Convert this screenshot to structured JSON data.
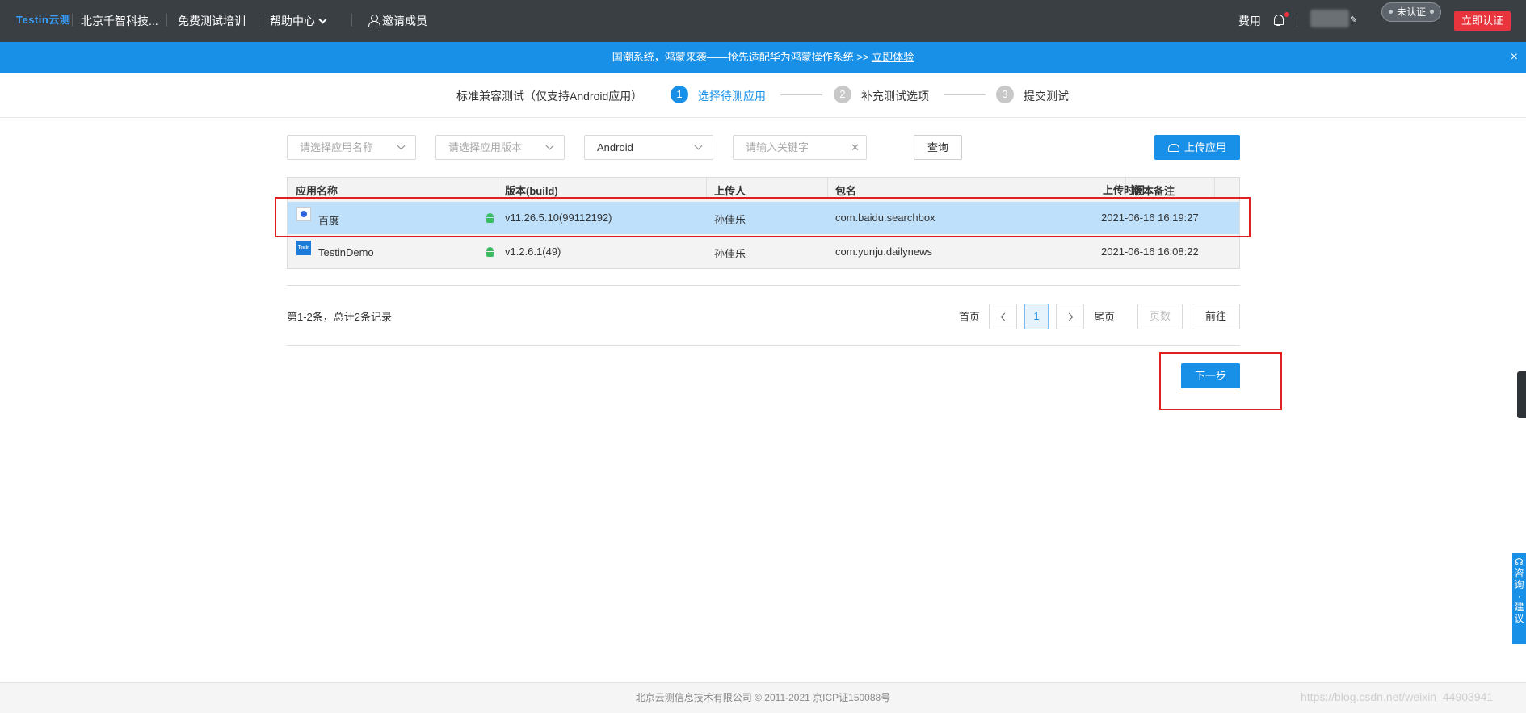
{
  "topnav": {
    "logo": "Testin云测",
    "company": "北京千智科技...",
    "training": "免费测试培训",
    "help": "帮助中心",
    "invite": "邀请成员",
    "fee": "费用",
    "unverified": "未认证",
    "certify": "立即认证"
  },
  "banner": {
    "text": "国潮系统，鸿蒙来袭——抢先适配华为鸿蒙操作系统 >> ",
    "link": "立即体验",
    "close": "×"
  },
  "steps": {
    "title": "标准兼容测试（仅支持Android应用）",
    "items": [
      {
        "num": "1",
        "label": "选择待测应用"
      },
      {
        "num": "2",
        "label": "补充测试选项"
      },
      {
        "num": "3",
        "label": "提交测试"
      }
    ]
  },
  "filters": {
    "app_name_placeholder": "请选择应用名称",
    "app_version_placeholder": "请选择应用版本",
    "platform": "Android",
    "keyword_placeholder": "请输入关键字",
    "query": "查询",
    "upload": "上传应用"
  },
  "table": {
    "headers": [
      "应用名称",
      "版本(build)",
      "上传人",
      "包名",
      "版本备注",
      "上传时间"
    ],
    "rows": [
      {
        "name": "百度",
        "version": "v11.26.5.10(99112192)",
        "uploader": "孙佳乐",
        "package": "com.baidu.searchbox",
        "note": "",
        "time": "2021-06-16 16:19:27"
      },
      {
        "name": "TestinDemo",
        "version": "v1.2.6.1(49)",
        "uploader": "孙佳乐",
        "package": "com.yunju.dailynews",
        "note": "",
        "time": "2021-06-16 16:08:22"
      }
    ]
  },
  "pagination": {
    "records": "第1-2条，总计2条记录",
    "first": "首页",
    "current": "1",
    "last": "尾页",
    "page_placeholder": "页数",
    "go": "前往"
  },
  "next_button": "下一步",
  "side_tab": [
    "咨",
    "询",
    "·",
    "建",
    "议"
  ],
  "footer": "北京云测信息技术有限公司 © 2011-2021 京ICP证150088号",
  "watermark": "https://blog.csdn.net/weixin_44903941",
  "colors": {
    "primary": "#1890e8",
    "danger": "#e8343c",
    "selected_row": "#bfe0fb",
    "topnav": "#3a3f44"
  }
}
